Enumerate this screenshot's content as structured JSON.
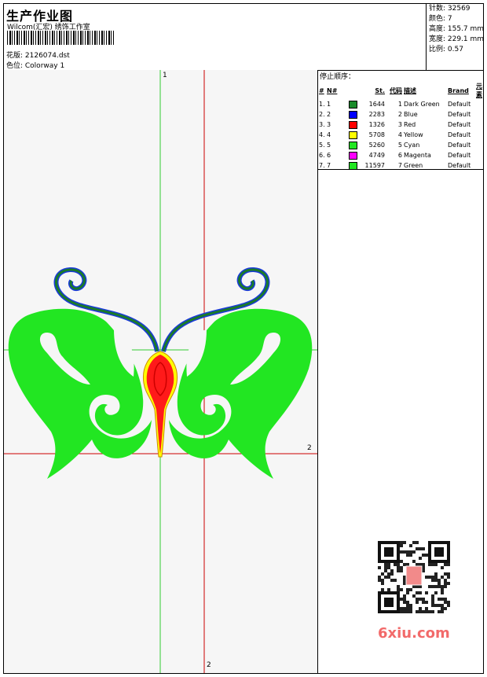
{
  "header": {
    "title": "生产作业图",
    "software": "Wilcom(汇宏) 绣饰工作室",
    "file_label": "花版: 2126074.dst",
    "colorway_label": "色位:  Colorway 1"
  },
  "stats": {
    "stitches": "针数: 32569",
    "colors": "颜色: 7",
    "height": "高度: 155.7 mm",
    "width": "宽度: 229.1 mm",
    "scale": "比例: 0.57"
  },
  "stop_sequence": {
    "title": "停止顺序：",
    "headers": [
      "#",
      "N#",
      "St.",
      "代码",
      "描述",
      "Brand",
      "元素"
    ],
    "rows": [
      {
        "n": "1.",
        "code": "1",
        "st": "1644",
        "num": "1",
        "desc": "Dark Green",
        "brand": "Default",
        "color": "#1a8a2a"
      },
      {
        "n": "2.",
        "code": "2",
        "st": "2283",
        "num": "2",
        "desc": "Blue",
        "brand": "Default",
        "color": "#0000ff"
      },
      {
        "n": "3.",
        "code": "3",
        "st": "1326",
        "num": "3",
        "desc": "Red",
        "brand": "Default",
        "color": "#ff0000"
      },
      {
        "n": "4.",
        "code": "4",
        "st": "5708",
        "num": "4",
        "desc": "Yellow",
        "brand": "Default",
        "color": "#ffff00"
      },
      {
        "n": "5.",
        "code": "5",
        "st": "5260",
        "num": "5",
        "desc": "Cyan",
        "brand": "Default",
        "color": "#22e622"
      },
      {
        "n": "6.",
        "code": "6",
        "st": "4749",
        "num": "6",
        "desc": "Magenta",
        "brand": "Default",
        "color": "#ff00ff"
      },
      {
        "n": "7.",
        "code": "7",
        "st": "11597",
        "num": "7",
        "desc": "Green",
        "brand": "Default",
        "color": "#22e622"
      }
    ]
  },
  "axes": {
    "v_top": "1",
    "h_right": "2",
    "v_bottom": "2"
  },
  "watermark": {
    "site": "6xiu.com",
    "seal_text": "刺绣图案"
  },
  "colors": {
    "grass": "#22e622",
    "dark_green": "#1a7a2a",
    "blue": "#1a3adb",
    "red": "#ff1a1a",
    "yellow": "#ffff00",
    "v_axis": "#33cc33",
    "h_axis": "#cc0000"
  }
}
